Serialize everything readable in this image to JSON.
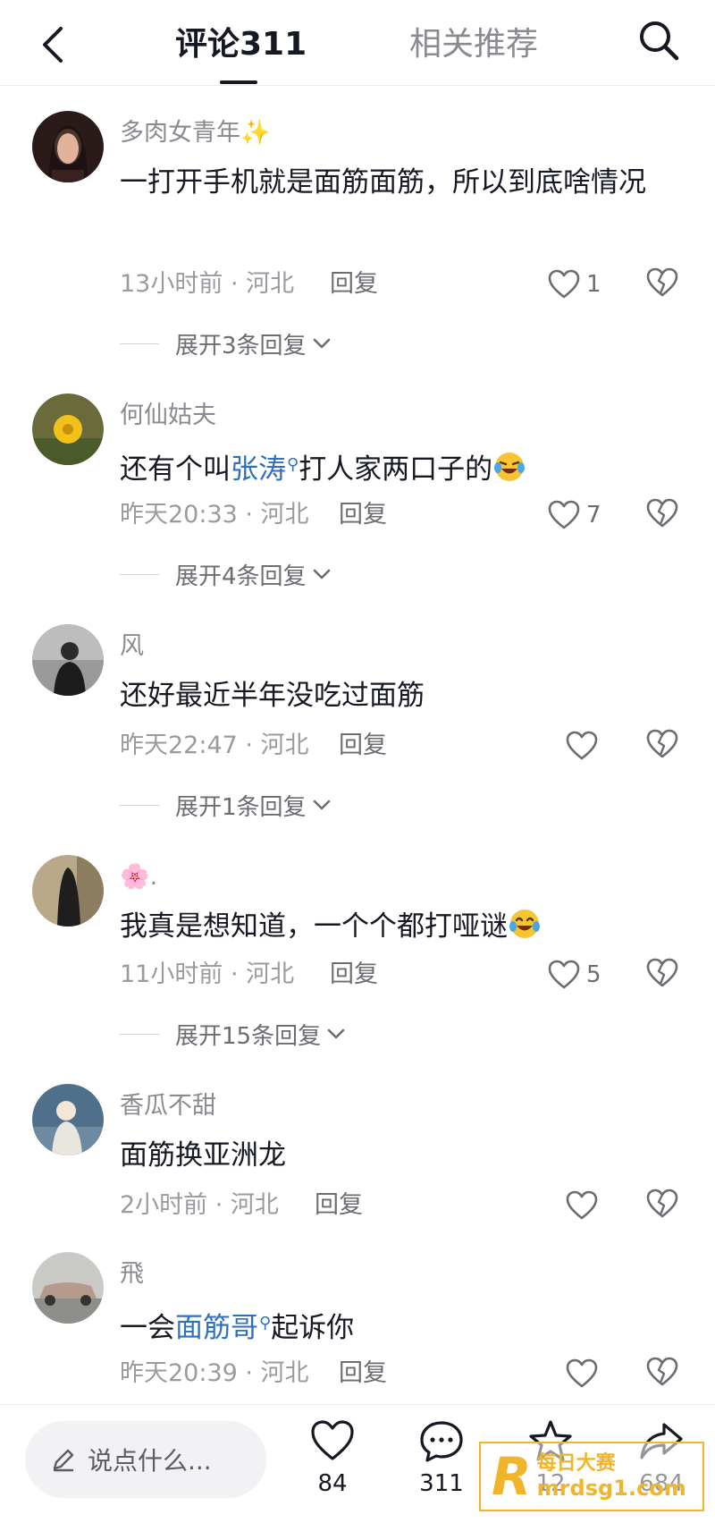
{
  "header": {
    "tab_comments": "评论311",
    "tab_related": "相关推荐"
  },
  "comments": [
    {
      "username": "多肉女青年",
      "username_suffix": "✨",
      "text_before": "一打开手机就是面筋面筋，所以到底啥情况",
      "mention": "",
      "text_after": "",
      "time_location": "13小时前 · 河北",
      "reply": "回复",
      "likes": "1",
      "expand": "展开3条回复"
    },
    {
      "username": "何仙姑夫",
      "username_suffix": "",
      "text_before": "还有个叫",
      "mention": "张涛",
      "text_after": "打人家两口子的",
      "emoji": "laughing-crying",
      "time_location": "昨天20:33 · 河北",
      "reply": "回复",
      "likes": "7",
      "expand": "展开4条回复"
    },
    {
      "username": "风",
      "username_suffix": "",
      "text_before": "还好最近半年没吃过面筋",
      "mention": "",
      "text_after": "",
      "time_location": "昨天22:47 · 河北",
      "reply": "回复",
      "likes": "",
      "expand": "展开1条回复"
    },
    {
      "username": "🌸.",
      "username_suffix": "",
      "text_before": "我真是想知道，一个个都打哑谜",
      "mention": "",
      "text_after": "",
      "emoji": "tears-of-joy",
      "time_location": "11小时前 · 河北",
      "reply": "回复",
      "likes": "5",
      "expand": "展开15条回复"
    },
    {
      "username": "香瓜不甜",
      "username_suffix": "",
      "text_before": "面筋换亚洲龙",
      "mention": "",
      "text_after": "",
      "time_location": "2小时前 · 河北",
      "reply": "回复",
      "likes": "",
      "expand": ""
    },
    {
      "username": "飛",
      "username_suffix": "",
      "text_before": "一会",
      "mention": "面筋哥",
      "text_after": "起诉你",
      "time_location": "昨天20:39 · 河北",
      "reply": "回复",
      "likes": "",
      "expand": ""
    }
  ],
  "bottom_bar": {
    "input_placeholder": "说点什么...",
    "like_count": "84",
    "comment_count": "311",
    "favorite_count": "12",
    "share_count": "684"
  },
  "watermark": {
    "top": "每日大赛",
    "bottom": "mrdsg1.com"
  },
  "colors": {
    "mention": "#2f6fbf",
    "watermark": "#f0b52a",
    "text_primary": "#161823",
    "text_secondary": "#8a8b91"
  }
}
